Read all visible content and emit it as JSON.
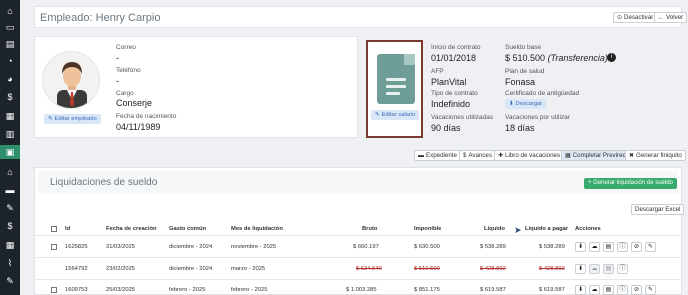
{
  "header": {
    "title": "Empleado: Henry Carpio",
    "deactivate_label": "Desactivar",
    "back_label": "Volver"
  },
  "employee": {
    "email_label": "Correo",
    "email_value": "-",
    "phone_label": "Teléfono",
    "phone_value": "-",
    "role_label": "Cargo",
    "role_value": "Conserje",
    "birth_label": "Fecha de nacimiento",
    "birth_value": "04/11/1989",
    "edit_employee": "Editar empleado",
    "edit_salary": "Editar salario"
  },
  "contract": {
    "start_label": "Inicio de contrato",
    "start_value": "01/01/2018",
    "salary_label": "Sueldo base",
    "salary_value": "$ 510.500",
    "salary_type": "(Transferencia)",
    "afp_label": "AFP",
    "afp_value": "PlanVital",
    "health_label": "Plan de salud",
    "health_value": "Fonasa",
    "type_label": "Tipo de contrato",
    "type_value": "Indefinido",
    "cert_label": "Certificado de antigüedad",
    "download_label": "Descargar",
    "vac_used_label": "Vacaciones utilizadas",
    "vac_used_value": "90 días",
    "vac_pending_label": "Vacaciones por utilizar",
    "vac_pending_value": "18 días"
  },
  "tabs": [
    "Expediente",
    "Avances",
    "Libro de vacaciones",
    "Completar Previred",
    "Generar finiquito"
  ],
  "payroll": {
    "title": "Liquidaciones de sueldo",
    "generate_label": "+ Generar liquidación de sueldo",
    "export_label": "Descargar Excel",
    "columns": [
      "Id",
      "Fecha de creación",
      "Gasto común",
      "Mes de liquidación",
      "Bruto",
      "Imponible",
      "Líquido",
      "Líquido a pagar",
      "Acciones"
    ],
    "rows": [
      {
        "id": "1625825",
        "created": "31/03/2025",
        "expense": "diciembre - 2024",
        "month": "noviembre - 2025",
        "gross": "$ 660.197",
        "taxable": "$ 630.500",
        "net": "$ 538.289",
        "pay": "$ 538.289",
        "void": false
      },
      {
        "id": "1564792",
        "created": "23/02/2025",
        "expense": "diciembre - 2024",
        "month": "marzo - 2025",
        "gross": "$ 534.540",
        "taxable": "$ 510.500",
        "net": "$ 428.892",
        "pay": "$ 428.892",
        "void": true
      },
      {
        "id": "1609753",
        "created": "25/03/2025",
        "expense": "febrero - 2025",
        "month": "febrero - 2025",
        "gross": "$ 1.003.285",
        "taxable": "$ 851.175",
        "net": "$ 619.587",
        "pay": "$ 619.587",
        "void": false
      }
    ]
  },
  "icons": {
    "sidebar": [
      "home-icon",
      "card-icon",
      "id-icon",
      "gauge-icon",
      "dollar-icon",
      "calculator-icon",
      "receipt-icon",
      "users-icon",
      "briefcase-icon",
      "bank-icon",
      "chat-icon",
      "wrench-icon",
      "dollar-icon",
      "calculator-icon",
      "chart-icon",
      "wrench-icon"
    ]
  },
  "colors": {
    "sidebar": "#1d232b",
    "accent": "#2f8f6a",
    "primary_button": "#3aab6e",
    "void_text": "#b03030"
  }
}
